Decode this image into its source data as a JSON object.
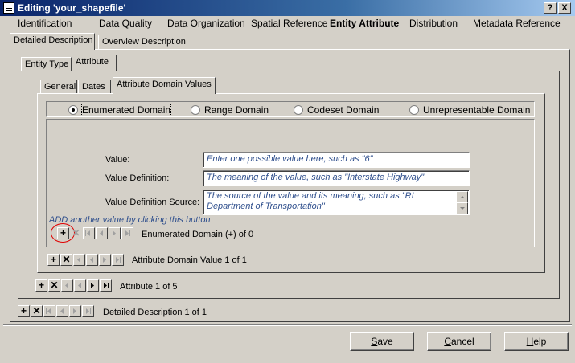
{
  "window": {
    "title": "Editing 'your_shapefile'",
    "help_btn": "?",
    "close_btn": "X"
  },
  "menu": [
    "Identification",
    "Data Quality",
    "Data Organization",
    "Spatial Reference",
    "Entity Attribute",
    "Distribution",
    "Metadata Reference"
  ],
  "tabs_level1": [
    "Detailed Description",
    "Overview Description"
  ],
  "tabs_level2": [
    "Entity Type",
    "Attribute"
  ],
  "tabs_level3": [
    "General",
    "Dates",
    "Attribute Domain Values"
  ],
  "domain_options": [
    {
      "label": "Enumerated Domain",
      "selected": true
    },
    {
      "label": "Range Domain",
      "selected": false
    },
    {
      "label": "Codeset Domain",
      "selected": false
    },
    {
      "label": "Unrepresentable Domain",
      "selected": false
    }
  ],
  "form": {
    "value_label": "Value:",
    "value_placeholder": "Enter one possible value here, such as \"6\"",
    "definition_label": "Value Definition:",
    "definition_placeholder": "The meaning of the value, such as \"Interstate Highway\"",
    "source_label": "Value Definition Source:",
    "source_placeholder": "The source of the value and its meaning, such as \"RI Department of Transportation\""
  },
  "hint": "ADD another value by clicking this button",
  "nav": {
    "enumerated": "Enumerated Domain (+) of 0",
    "domain_value": "Attribute Domain Value 1 of 1",
    "attribute": "Attribute 1 of 5",
    "detailed": "Detailed Description 1 of 1"
  },
  "buttons": {
    "save": {
      "prefix": "",
      "accel": "S",
      "rest": "ave"
    },
    "cancel": {
      "prefix": "",
      "accel": "C",
      "rest": "ancel"
    },
    "help": {
      "prefix": "",
      "accel": "H",
      "rest": "elp"
    }
  }
}
